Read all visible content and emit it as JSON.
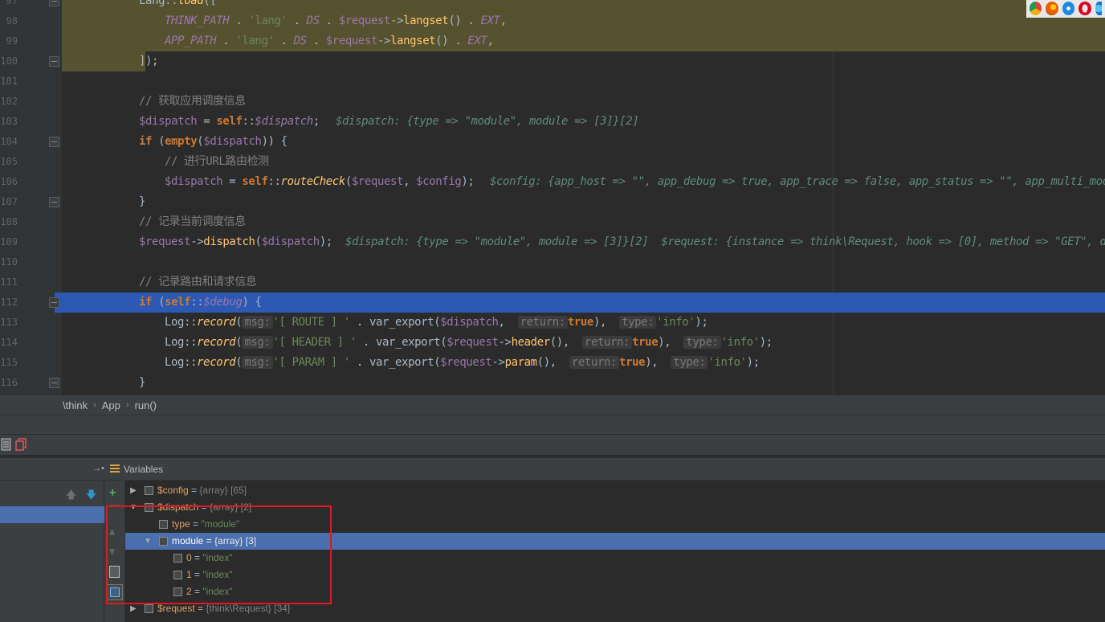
{
  "code": {
    "lines": [
      {
        "n": "97",
        "tokens": [
          [
            "plain",
            "Lang::"
          ],
          [
            "static",
            "load"
          ],
          [
            "plain",
            "(["
          ]
        ]
      },
      {
        "n": "98",
        "tokens": [
          [
            "const",
            "THINK_PATH"
          ],
          [
            "plain",
            " . "
          ],
          [
            "str",
            "'lang'"
          ],
          [
            "plain",
            " . "
          ],
          [
            "const",
            "DS"
          ],
          [
            "plain",
            " . "
          ],
          [
            "var",
            "$request"
          ],
          [
            "plain",
            "->"
          ],
          [
            "fn",
            "langset"
          ],
          [
            "plain",
            "() . "
          ],
          [
            "const",
            "EXT"
          ],
          [
            "plain",
            ","
          ]
        ]
      },
      {
        "n": "99",
        "tokens": [
          [
            "const",
            "APP_PATH"
          ],
          [
            "plain",
            " . "
          ],
          [
            "str",
            "'lang'"
          ],
          [
            "plain",
            " . "
          ],
          [
            "const",
            "DS"
          ],
          [
            "plain",
            " . "
          ],
          [
            "var",
            "$request"
          ],
          [
            "plain",
            "->"
          ],
          [
            "fn",
            "langset"
          ],
          [
            "plain",
            "() . "
          ],
          [
            "const",
            "EXT"
          ],
          [
            "plain",
            ","
          ]
        ]
      },
      {
        "n": "100",
        "tokens": [
          [
            "plain",
            "]);"
          ]
        ]
      },
      {
        "n": "101",
        "tokens": []
      },
      {
        "n": "102",
        "tokens": [
          [
            "cmt",
            "// 获取应用调度信息"
          ]
        ]
      },
      {
        "n": "103",
        "tokens": [
          [
            "var",
            "$dispatch"
          ],
          [
            "plain",
            " = "
          ],
          [
            "kw",
            "self"
          ],
          [
            "plain",
            "::"
          ],
          [
            "varI",
            "$dispatch"
          ],
          [
            "plain",
            ";"
          ]
        ]
      },
      {
        "n": "104",
        "tokens": [
          [
            "kw",
            "if"
          ],
          [
            "plain",
            " ("
          ],
          [
            "kw",
            "empty"
          ],
          [
            "plain",
            "("
          ],
          [
            "var",
            "$dispatch"
          ],
          [
            "plain",
            ")) {"
          ]
        ]
      },
      {
        "n": "105",
        "tokens": [
          [
            "cmt",
            "// 进行URL路由检测"
          ]
        ]
      },
      {
        "n": "106",
        "tokens": [
          [
            "var",
            "$dispatch"
          ],
          [
            "plain",
            " = "
          ],
          [
            "kw",
            "self"
          ],
          [
            "plain",
            "::"
          ],
          [
            "static",
            "routeCheck"
          ],
          [
            "plain",
            "("
          ],
          [
            "var",
            "$request"
          ],
          [
            "plain",
            ", "
          ],
          [
            "var",
            "$config"
          ],
          [
            "plain",
            ");"
          ]
        ]
      },
      {
        "n": "107",
        "tokens": [
          [
            "plain",
            "}"
          ]
        ]
      },
      {
        "n": "108",
        "tokens": [
          [
            "cmt",
            "// 记录当前调度信息"
          ]
        ]
      },
      {
        "n": "109",
        "tokens": [
          [
            "var",
            "$request"
          ],
          [
            "plain",
            "->"
          ],
          [
            "fn",
            "dispatch"
          ],
          [
            "plain",
            "("
          ],
          [
            "var",
            "$dispatch"
          ],
          [
            "plain",
            ");"
          ]
        ]
      },
      {
        "n": "110",
        "tokens": []
      },
      {
        "n": "111",
        "tokens": [
          [
            "cmt",
            "// 记录路由和请求信息"
          ]
        ]
      },
      {
        "n": "112",
        "tokens": [
          [
            "kw",
            "if"
          ],
          [
            "plain",
            " ("
          ],
          [
            "kw",
            "self"
          ],
          [
            "plain",
            "::"
          ],
          [
            "varI",
            "$debug"
          ],
          [
            "plain",
            ") {"
          ]
        ]
      },
      {
        "n": "113",
        "tokens": [
          [
            "plain",
            "Log::"
          ],
          [
            "static",
            "record"
          ],
          [
            "plain",
            "("
          ],
          [
            "pill",
            "msg:"
          ],
          [
            "str",
            "'[ ROUTE ] '"
          ],
          [
            "plain",
            " . var_export("
          ],
          [
            "var",
            "$dispatch"
          ],
          [
            "plain",
            ",  "
          ],
          [
            "pill",
            "return:"
          ],
          [
            "kw",
            "true"
          ],
          [
            "plain",
            "),  "
          ],
          [
            "pill",
            "type:"
          ],
          [
            "str",
            "'info'"
          ],
          [
            "plain",
            ");"
          ]
        ]
      },
      {
        "n": "114",
        "tokens": [
          [
            "plain",
            "Log::"
          ],
          [
            "static",
            "record"
          ],
          [
            "plain",
            "("
          ],
          [
            "pill",
            "msg:"
          ],
          [
            "str",
            "'[ HEADER ] '"
          ],
          [
            "plain",
            " . var_export("
          ],
          [
            "var",
            "$request"
          ],
          [
            "plain",
            "->"
          ],
          [
            "fn",
            "header"
          ],
          [
            "plain",
            "(),  "
          ],
          [
            "pill",
            "return:"
          ],
          [
            "kw",
            "true"
          ],
          [
            "plain",
            "),  "
          ],
          [
            "pill",
            "type:"
          ],
          [
            "str",
            "'info'"
          ],
          [
            "plain",
            ");"
          ]
        ]
      },
      {
        "n": "115",
        "tokens": [
          [
            "plain",
            "Log::"
          ],
          [
            "static",
            "record"
          ],
          [
            "plain",
            "("
          ],
          [
            "pill",
            "msg:"
          ],
          [
            "str",
            "'[ PARAM ] '"
          ],
          [
            "plain",
            " . var_export("
          ],
          [
            "var",
            "$request"
          ],
          [
            "plain",
            "->"
          ],
          [
            "fn",
            "param"
          ],
          [
            "plain",
            "(),  "
          ],
          [
            "pill",
            "return:"
          ],
          [
            "kw",
            "true"
          ],
          [
            "plain",
            "),  "
          ],
          [
            "pill",
            "type:"
          ],
          [
            "str",
            "'info'"
          ],
          [
            "plain",
            ");"
          ]
        ]
      },
      {
        "n": "116",
        "tokens": [
          [
            "plain",
            "}"
          ]
        ]
      }
    ],
    "hints": {
      "103": "$dispatch: {type => \"module\", module => [3]}[2]",
      "106": "$config: {app_host => \"\", app_debug => true, app_trace => false, app_status => \"\", app_multi_module",
      "109": "$dispatch: {type => \"module\", module => [3]}[2]  $request: {instance => think\\Request, hook => [0], method => \"GET\", do"
    }
  },
  "breadcrumb": [
    "\\think",
    "App",
    "run()"
  ],
  "variables": {
    "title": "Variables",
    "rows": [
      {
        "name": "$config",
        "eq": " = ",
        "meta": "{array} [65]",
        "value": ""
      },
      {
        "name": "$dispatch",
        "eq": " = ",
        "meta": "{array} [2]",
        "value": ""
      },
      {
        "name": "type",
        "eq": " = ",
        "meta": "",
        "value": "\"module\""
      },
      {
        "name": "module",
        "eq": " = ",
        "meta": "{array} [3]",
        "value": ""
      },
      {
        "name": "0",
        "eq": " = ",
        "meta": "",
        "value": "\"index\""
      },
      {
        "name": "1",
        "eq": " = ",
        "meta": "",
        "value": "\"index\""
      },
      {
        "name": "2",
        "eq": " = ",
        "meta": "",
        "value": "\"index\""
      },
      {
        "name": "$request",
        "eq": " = ",
        "meta": "{think\\Request} [34]",
        "value": ""
      }
    ]
  },
  "colors": {
    "execution_line": "#2d59b3",
    "selection": "#4b6eaf",
    "highlight_box": "#e3171f"
  }
}
